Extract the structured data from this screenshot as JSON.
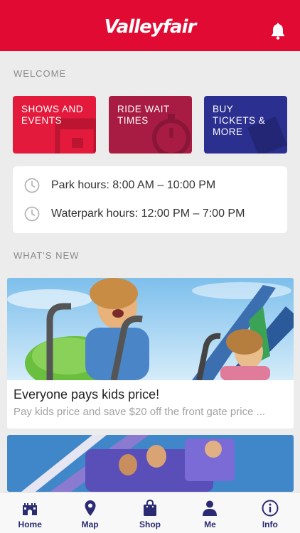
{
  "header": {
    "logo_text": "Valleyfair",
    "brand_color": "#e10a32"
  },
  "welcome": {
    "section_label": "WELCOME",
    "tiles": [
      {
        "label": "SHOWS AND EVENTS",
        "color": "#e41a3c",
        "icon": "calendar-icon"
      },
      {
        "label": "RIDE WAIT TIMES",
        "color": "#a81c44",
        "icon": "stopwatch-icon"
      },
      {
        "label": "BUY TICKETS & MORE",
        "color": "#2b2f8f",
        "icon": "ticket-icon"
      }
    ]
  },
  "hours": [
    {
      "text": "Park hours: 8:00 AM – 10:00 PM",
      "icon": "clock-icon"
    },
    {
      "text": "Waterpark hours: 12:00 PM – 7:00 PM",
      "icon": "clock-icon"
    }
  ],
  "whats_new": {
    "section_label": "WHAT'S NEW",
    "cards": [
      {
        "title": "Everyone pays kids price!",
        "subtitle": "Pay kids price and save $20 off the front gate price ..."
      }
    ]
  },
  "tabbar": {
    "items": [
      {
        "label": "Home",
        "icon": "castle-icon",
        "active": true
      },
      {
        "label": "Map",
        "icon": "map-pin-icon"
      },
      {
        "label": "Shop",
        "icon": "shopping-bag-icon"
      },
      {
        "label": "Me",
        "icon": "person-icon"
      },
      {
        "label": "Info",
        "icon": "info-icon"
      }
    ]
  }
}
